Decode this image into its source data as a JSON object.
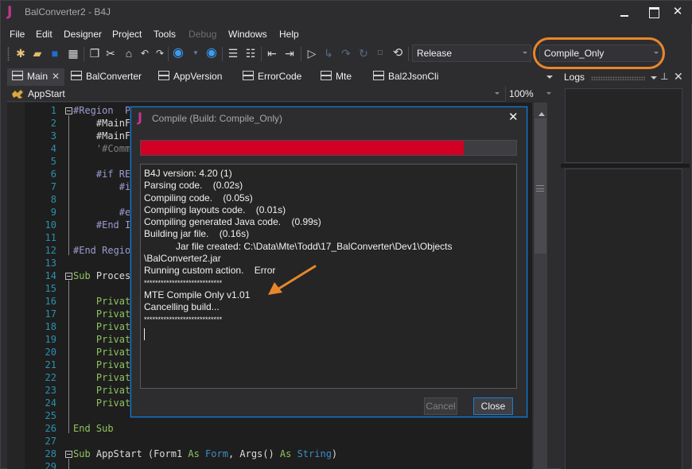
{
  "window": {
    "app_icon": "J",
    "title": "BalConverter2 - B4J",
    "controls": {
      "minimize": "minimize-icon",
      "maximize": "maximize-icon",
      "close": "✕"
    }
  },
  "menu": {
    "items": [
      {
        "label": "File",
        "enabled": true
      },
      {
        "label": "Edit",
        "enabled": true
      },
      {
        "label": "Designer",
        "enabled": true
      },
      {
        "label": "Project",
        "enabled": true
      },
      {
        "label": "Tools",
        "enabled": true
      },
      {
        "label": "Debug",
        "enabled": false
      },
      {
        "label": "Windows",
        "enabled": true
      },
      {
        "label": "Help",
        "enabled": true
      }
    ]
  },
  "toolbar": {
    "icons": [
      "new-project-icon",
      "open-project-icon",
      "save-icon",
      "save-all-icon",
      "copy-icon",
      "cut-icon",
      "paste-icon",
      "undo-icon",
      "redo-icon",
      "navigate-back-icon",
      "navigate-back-dropdown-icon",
      "navigate-forward-icon",
      "comment-block-icon",
      "uncomment-block-icon",
      "outdent-icon",
      "indent-icon",
      "run-icon",
      "step-in-icon",
      "step-over-icon",
      "step-out-icon",
      "stop-icon",
      "restart-icon"
    ],
    "build_config": "Release",
    "build_action": "Compile_Only"
  },
  "tabs": [
    {
      "label": "Main",
      "active": true,
      "closable": true
    },
    {
      "label": "BalConverter",
      "active": false
    },
    {
      "label": "AppVersion",
      "active": false
    },
    {
      "label": "ErrorCode",
      "active": false
    },
    {
      "label": "Mte",
      "active": false
    },
    {
      "label": "Bal2JsonCli",
      "active": false
    }
  ],
  "subnav": {
    "sub_name": "AppStart",
    "zoom": "100%"
  },
  "editor": {
    "lines": [
      {
        "n": "1",
        "parts": [
          [
            "#Region  P",
            "region"
          ]
        ],
        "indent": 0,
        "fold": true
      },
      {
        "n": "2",
        "parts": [
          [
            "#MainF",
            "white"
          ]
        ],
        "indent": 4
      },
      {
        "n": "3",
        "parts": [
          [
            "#MainF",
            "white"
          ]
        ],
        "indent": 4
      },
      {
        "n": "4",
        "parts": [
          [
            "'#Comm",
            "comment"
          ]
        ],
        "indent": 4
      },
      {
        "n": "5",
        "parts": [],
        "indent": 0
      },
      {
        "n": "6",
        "parts": [
          [
            "#if RE",
            "region"
          ]
        ],
        "indent": 4
      },
      {
        "n": "7",
        "parts": [
          [
            "#i",
            "region"
          ]
        ],
        "indent": 8
      },
      {
        "n": "8",
        "parts": [],
        "indent": 0
      },
      {
        "n": "9",
        "parts": [
          [
            "#e",
            "region"
          ]
        ],
        "indent": 8
      },
      {
        "n": "10",
        "parts": [
          [
            "#End I",
            "region"
          ]
        ],
        "indent": 4
      },
      {
        "n": "11",
        "parts": [],
        "indent": 0
      },
      {
        "n": "12",
        "parts": [
          [
            "#End Regio",
            "region"
          ]
        ],
        "indent": 0
      },
      {
        "n": "13",
        "parts": [],
        "indent": 0
      },
      {
        "n": "14",
        "parts": [
          [
            "Sub ",
            "sub"
          ],
          [
            "Proces",
            "white"
          ]
        ],
        "indent": 0,
        "fold": true
      },
      {
        "n": "15",
        "parts": [],
        "indent": 0
      },
      {
        "n": "16",
        "parts": [
          [
            "Privat",
            "sub"
          ]
        ],
        "indent": 4
      },
      {
        "n": "17",
        "parts": [
          [
            "Privat",
            "sub"
          ]
        ],
        "indent": 4
      },
      {
        "n": "18",
        "parts": [
          [
            "Privat",
            "sub"
          ]
        ],
        "indent": 4
      },
      {
        "n": "19",
        "parts": [
          [
            "Privat",
            "sub"
          ]
        ],
        "indent": 4
      },
      {
        "n": "20",
        "parts": [
          [
            "Privat",
            "sub"
          ]
        ],
        "indent": 4
      },
      {
        "n": "21",
        "parts": [
          [
            "Privat",
            "sub"
          ]
        ],
        "indent": 4
      },
      {
        "n": "22",
        "parts": [
          [
            "Privat",
            "sub"
          ]
        ],
        "indent": 4
      },
      {
        "n": "23",
        "parts": [
          [
            "Privat",
            "sub"
          ]
        ],
        "indent": 4
      },
      {
        "n": "24",
        "parts": [
          [
            "Privat",
            "sub"
          ]
        ],
        "indent": 4
      },
      {
        "n": "25",
        "parts": [],
        "indent": 0
      },
      {
        "n": "26",
        "parts": [
          [
            "End Sub",
            "sub"
          ]
        ],
        "indent": 0
      },
      {
        "n": "27",
        "parts": [],
        "indent": 0
      },
      {
        "n": "28",
        "parts": [
          [
            "Sub ",
            "sub"
          ],
          [
            "AppStart",
            "white"
          ],
          [
            " (Form1 ",
            "white"
          ],
          [
            "As ",
            "sub"
          ],
          [
            "Form",
            "type"
          ],
          [
            ", Args() ",
            "white"
          ],
          [
            "As ",
            "sub"
          ],
          [
            "String",
            "type"
          ],
          [
            ")",
            "white"
          ]
        ],
        "indent": 0,
        "fold": true
      },
      {
        "n": "29",
        "parts": [],
        "indent": 0
      }
    ]
  },
  "logs_panel": {
    "title": "Logs"
  },
  "dialog": {
    "icon": "J",
    "title": "Compile (Build: Compile_Only)",
    "progress_percent": 86,
    "progress_color": "#d10024",
    "log_lines": [
      "B4J version: 4.20 (1)",
      "Parsing code.    (0.02s)",
      "Compiling code.    (0.05s)",
      "Compiling layouts code.    (0.01s)",
      "Compiling generated Java code.    (0.99s)",
      "Building jar file.    (0.16s)",
      "            Jar file created: C:\\Data\\Mte\\Todd\\17_BalConverter\\Dev1\\Objects",
      "\\BalConverter2.jar",
      "Running custom action.    Error",
      "****************************",
      "MTE Compile Only v1.01",
      "Cancelling build...",
      "****************************"
    ],
    "cancel_label": "Cancel",
    "cancel_enabled": false,
    "close_label": "Close"
  },
  "annotation": {
    "highlight_color": "#e8872a"
  }
}
